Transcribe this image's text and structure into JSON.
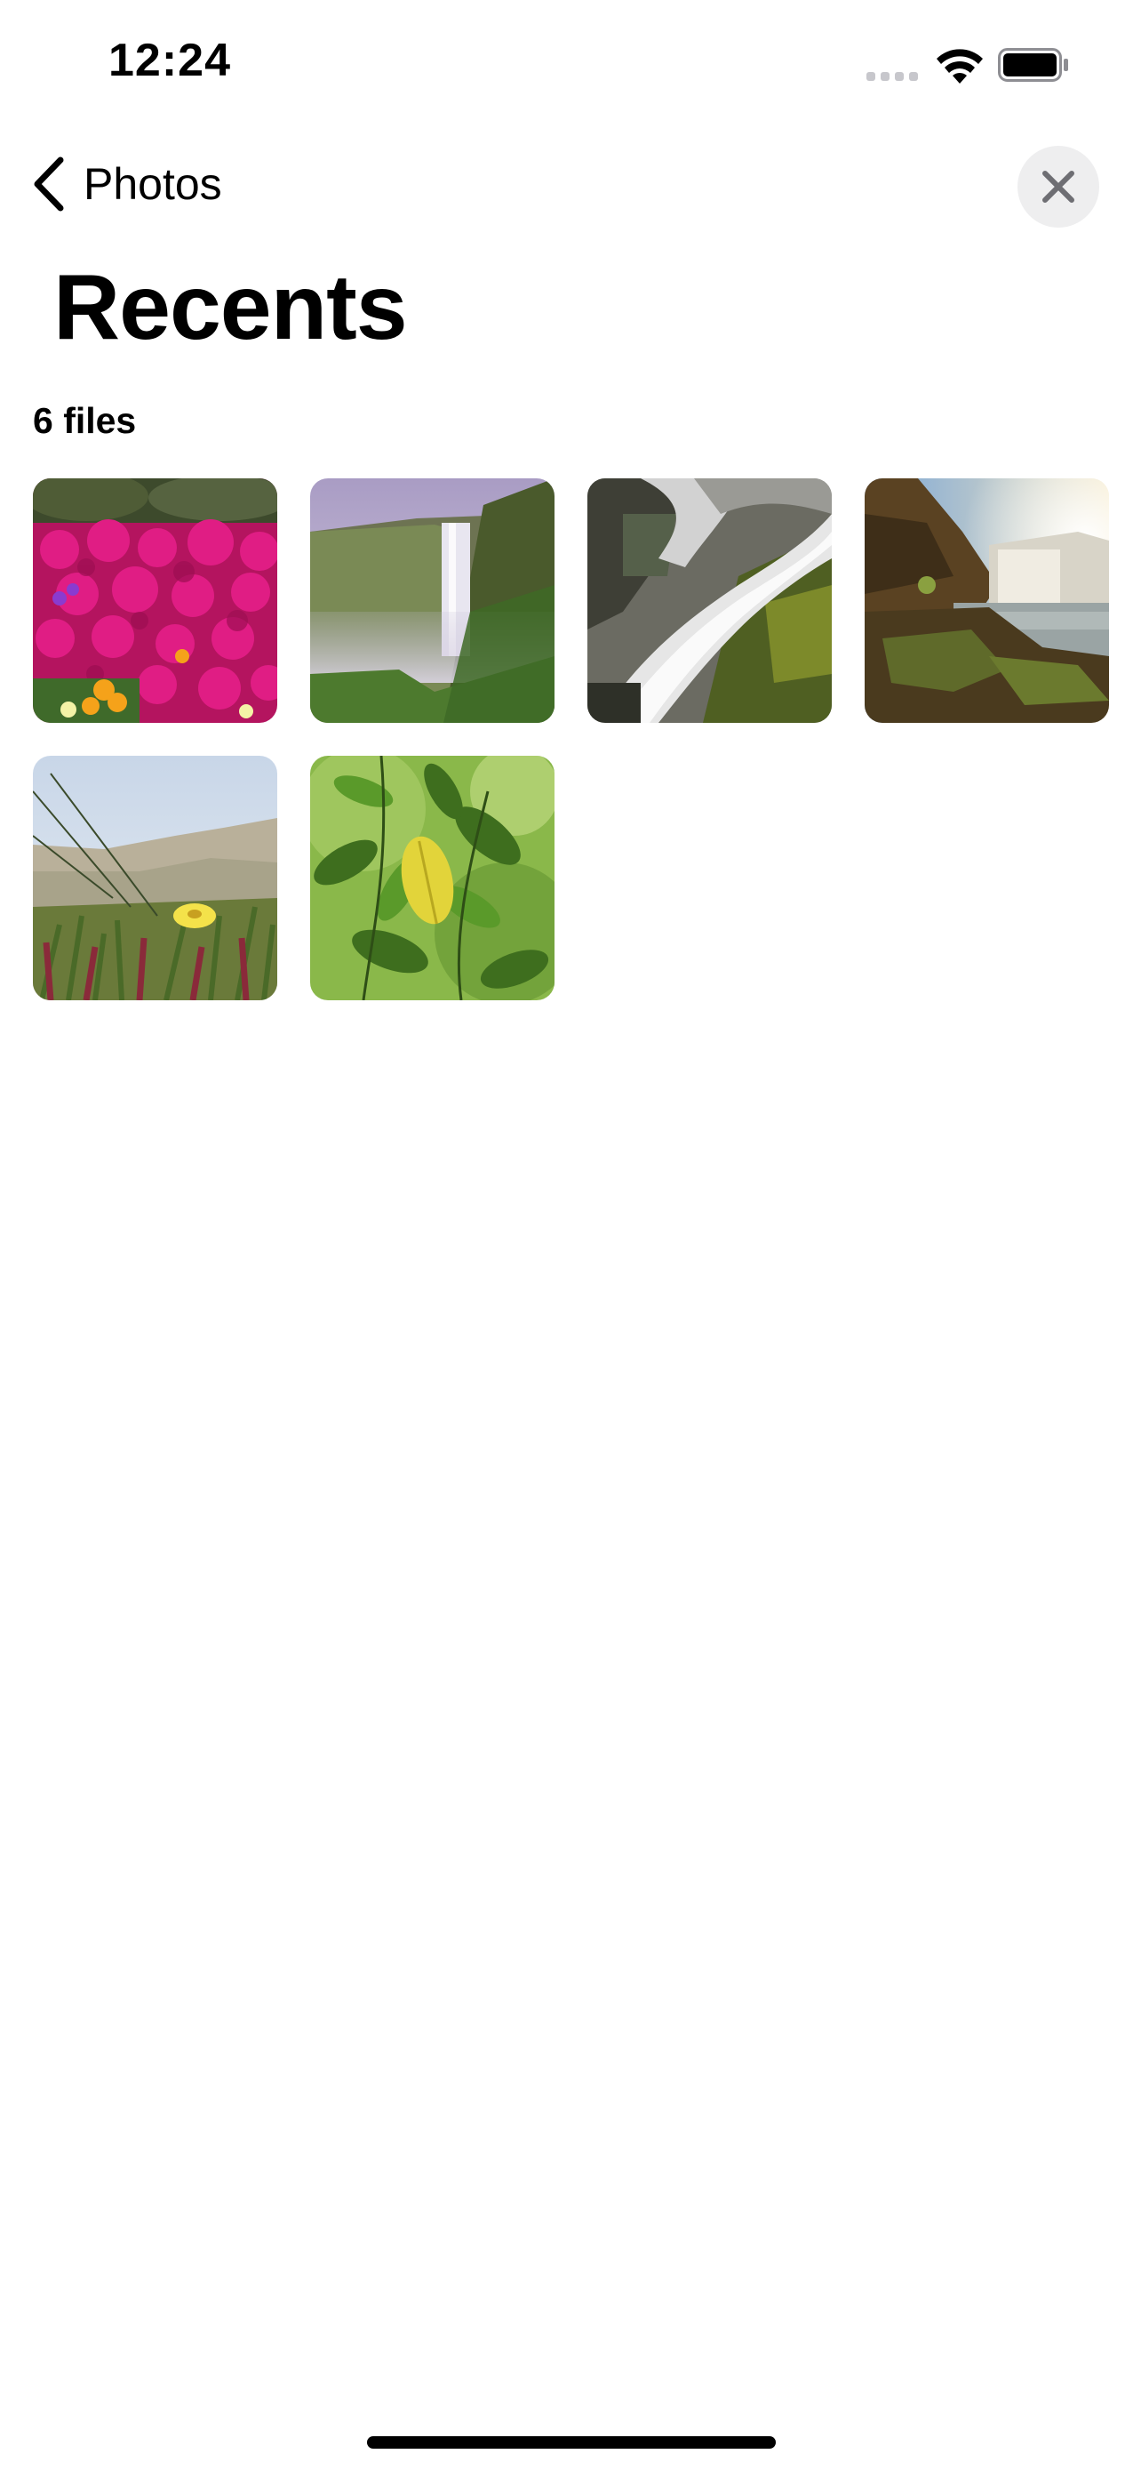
{
  "status_bar": {
    "time": "12:24",
    "wifi_icon": "wifi-icon",
    "battery_icon": "battery-icon",
    "signal_icon": "cellular-signal-icon"
  },
  "nav": {
    "back_label": "Photos",
    "back_icon": "chevron-left-icon",
    "close_icon": "close-icon"
  },
  "page": {
    "title": "Recents",
    "file_count": "6 files"
  },
  "photos": [
    {
      "subject": "magenta flowers",
      "dominant_color": "#c4166e"
    },
    {
      "subject": "waterfall in misty canyon",
      "dominant_color": "#8a8aa0"
    },
    {
      "subject": "waterfall over mossy rocks",
      "dominant_color": "#bdbdbd"
    },
    {
      "subject": "waterfall at sunset",
      "dominant_color": "#6b5a3a"
    },
    {
      "subject": "dune grass with yellow flower",
      "dominant_color": "#8a9a6a"
    },
    {
      "subject": "green leaves with yellow leaf",
      "dominant_color": "#5e8a2e"
    }
  ],
  "colors": {
    "background": "#ffffff",
    "close_button_bg": "#eeeeef",
    "text": "#000000"
  }
}
